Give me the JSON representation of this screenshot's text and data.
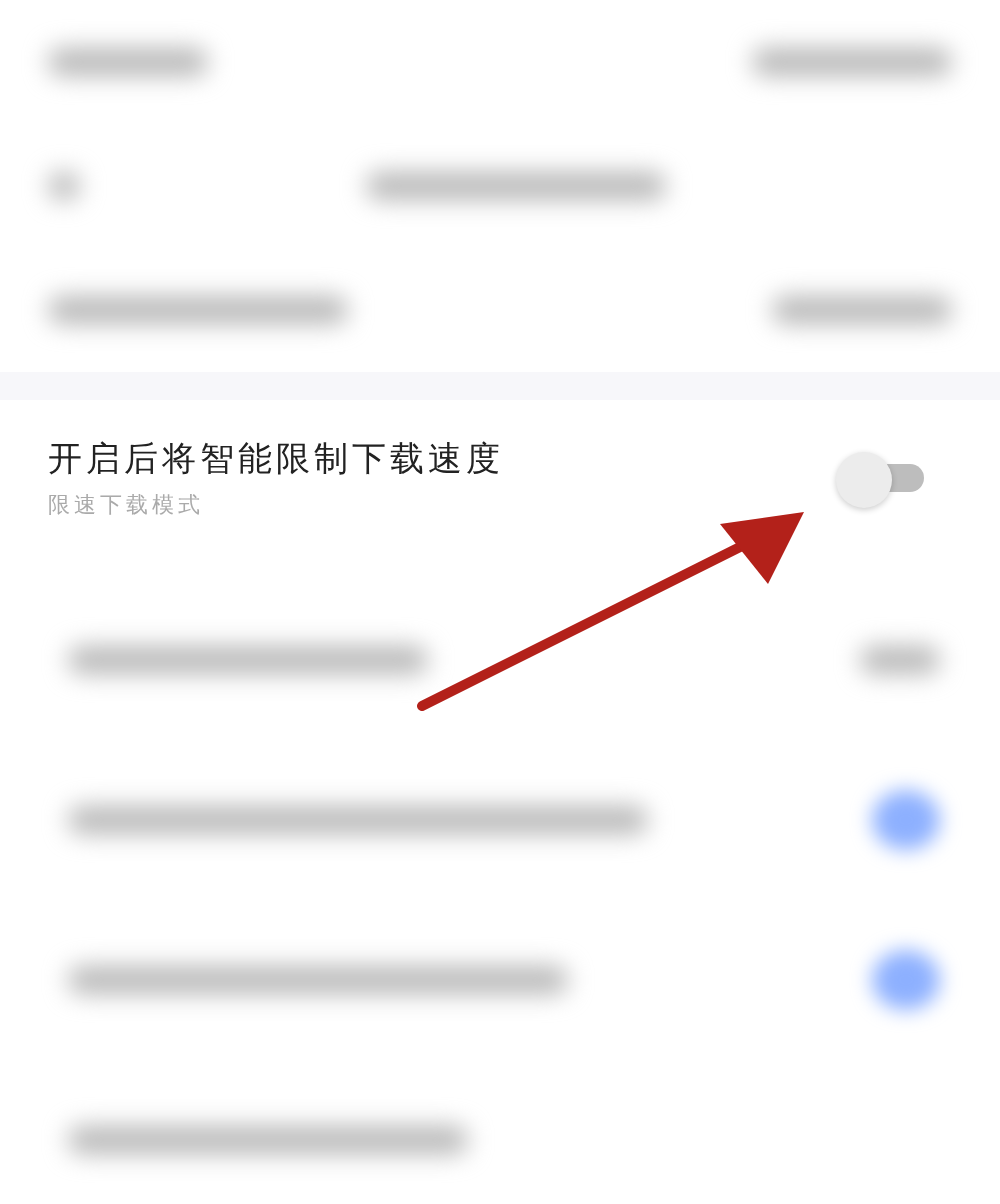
{
  "blurred_header": [
    {
      "kind": "status"
    },
    {
      "kind": "nav"
    },
    {
      "kind": "row"
    }
  ],
  "setting": {
    "title": "开启后将智能限制下载速度",
    "subtitle": "限速下载模式",
    "on": false
  },
  "blurred_rows": [
    {
      "kind": "value"
    },
    {
      "kind": "switch",
      "on": true
    },
    {
      "kind": "switch",
      "on": true
    },
    {
      "kind": "plain"
    }
  ],
  "annotation": {
    "kind": "arrow",
    "color": "#b3211a"
  }
}
